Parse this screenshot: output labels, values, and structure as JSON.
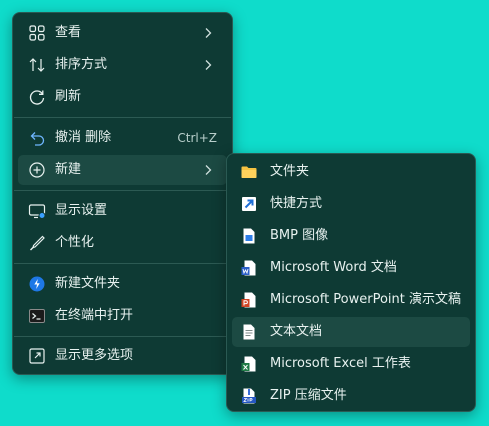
{
  "main_menu": {
    "items": [
      {
        "label": "查看",
        "icon": "view-grid-icon",
        "has_submenu": true
      },
      {
        "label": "排序方式",
        "icon": "sort-icon",
        "has_submenu": true
      },
      {
        "label": "刷新",
        "icon": "refresh-icon"
      },
      {
        "label": "撤消 删除",
        "icon": "undo-icon",
        "shortcut": "Ctrl+Z"
      },
      {
        "label": "新建",
        "icon": "new-plus-icon",
        "has_submenu": true,
        "active": true
      },
      {
        "label": "显示设置",
        "icon": "display-settings-icon"
      },
      {
        "label": "个性化",
        "icon": "personalize-brush-icon"
      },
      {
        "label": "新建文件夹",
        "icon": "new-folder-app-icon"
      },
      {
        "label": "在终端中打开",
        "icon": "terminal-icon"
      },
      {
        "label": "显示更多选项",
        "icon": "more-options-icon"
      }
    ]
  },
  "sub_menu": {
    "items": [
      {
        "label": "文件夹",
        "icon": "folder-icon"
      },
      {
        "label": "快捷方式",
        "icon": "shortcut-icon"
      },
      {
        "label": "BMP 图像",
        "icon": "bmp-image-icon"
      },
      {
        "label": "Microsoft Word 文档",
        "icon": "word-document-icon"
      },
      {
        "label": "Microsoft PowerPoint 演示文稿",
        "icon": "powerpoint-icon"
      },
      {
        "label": "文本文档",
        "icon": "text-document-icon",
        "hovered": true
      },
      {
        "label": "Microsoft Excel 工作表",
        "icon": "excel-icon"
      },
      {
        "label": "ZIP 压缩文件",
        "icon": "zip-icon"
      }
    ]
  },
  "colors": {
    "desktop": "#0fdccb",
    "menu_bg": "#0e3a34",
    "hover_bg": "#1c4a43",
    "text": "#e8f2f0",
    "separator": "#2c5a53"
  }
}
